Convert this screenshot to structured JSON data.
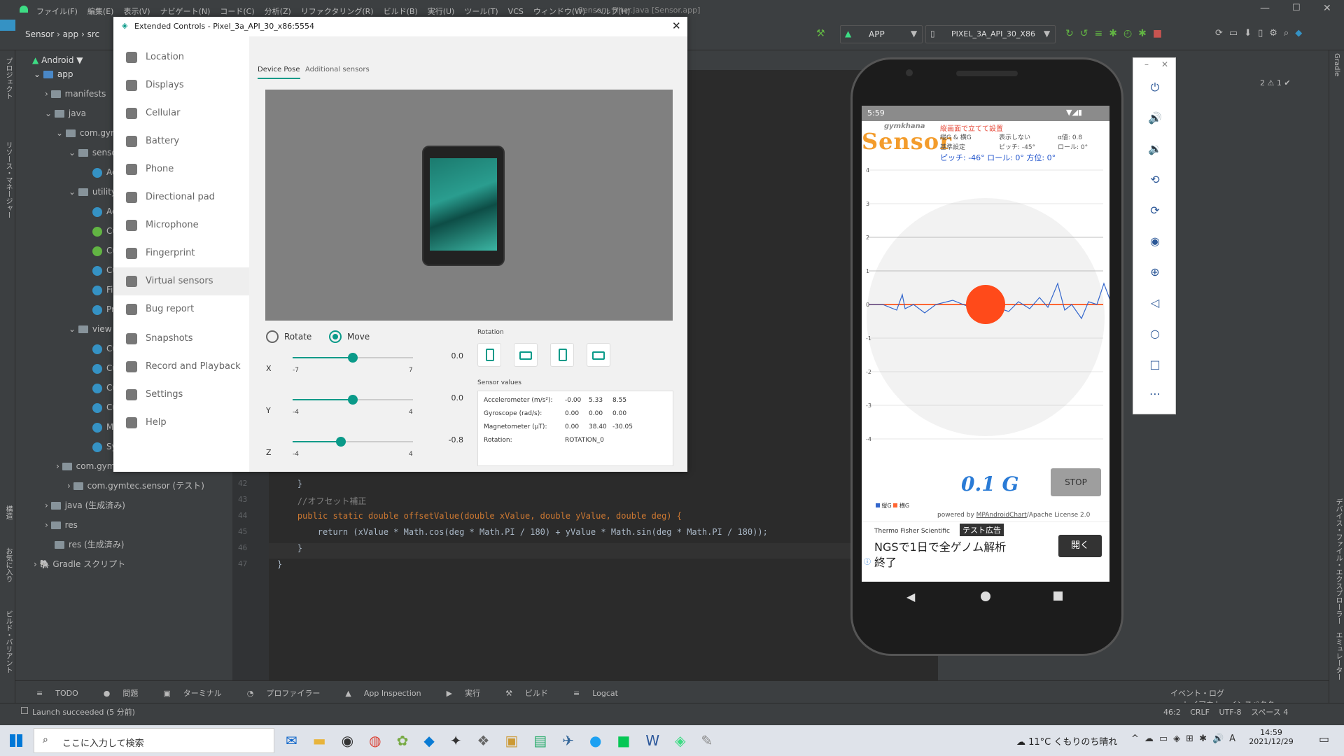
{
  "ide": {
    "menu": [
      "ファイル(F)",
      "編集(E)",
      "表示(V)",
      "ナビゲート(N)",
      "コード(C)",
      "分析(Z)",
      "リファクタリング(R)",
      "ビルド(B)",
      "実行(U)",
      "ツール(T)",
      "VCS",
      "ウィンドウ(W)",
      "ヘルプ(H)"
    ],
    "window_title": "Sensor - Filter.java [Sensor.app]",
    "breadcrumb": [
      "Sensor",
      "app",
      "src"
    ],
    "run_config": "APP",
    "device": "PIXEL_3A_API_30_X86",
    "project_view": "Android",
    "left_tool_tabs": [
      "プロジェクト",
      "リソース・マネージャー",
      "構造",
      "お気に入り",
      "ビルド・バリアント"
    ],
    "right_tool_tabs": [
      "Gradle",
      "デバイス・ファイル・エクスプローラー",
      "エミュレーター"
    ],
    "tree": {
      "app": "app",
      "manifests": "manifests",
      "java": "java",
      "pkg1": "com.gym",
      "senso": "senso",
      "utility": "utility",
      "view": "view",
      "leaf_ac": "Ac",
      "leaf_cu": "Cu",
      "leaf_fil": "Fil",
      "leaf_pr": "Pr",
      "leaf_ma": "Ma",
      "leaf_sy": "Sy",
      "pkg2": "com.gym",
      "pkg_test": "com.gymtec.sensor (テスト)",
      "java_gen": "java (生成済み)",
      "res": "res",
      "res_gen": "res (生成済み)",
      "gradle": "Gradle スクリプト"
    },
    "inspection": "2 ⚠  1 ✔",
    "code_lines": [
      {
        "n": "42",
        "t": "    }"
      },
      {
        "n": "43",
        "t": "    //オフセット補正"
      },
      {
        "n": "44",
        "t": "    public static double offsetValue(double xValue, double yValue, double deg) {"
      },
      {
        "n": "45",
        "t": "        return (xValue * Math.cos(deg * Math.PI / 180) + yValue * Math.sin(deg * Math.PI / 180));"
      },
      {
        "n": "46",
        "t": "    }"
      },
      {
        "n": "47",
        "t": "}"
      }
    ],
    "bottom_tabs": [
      "TODO",
      "問題",
      "ターミナル",
      "プロファイラー",
      "App Inspection",
      "実行",
      "ビルド",
      "Logcat"
    ],
    "bottom_right_tabs": [
      "イベント・ログ",
      "レイアウト・インスペクター"
    ],
    "status_message": "Launch succeeded (5 分前)",
    "status_right": {
      "pos": "46:2",
      "eol": "CRLF",
      "enc": "UTF-8",
      "indent": "スペース 4"
    }
  },
  "extended_controls": {
    "title": "Extended Controls - Pixel_3a_API_30_x86:5554",
    "nav": [
      "Location",
      "Displays",
      "Cellular",
      "Battery",
      "Phone",
      "Directional pad",
      "Microphone",
      "Fingerprint",
      "Virtual sensors",
      "Bug report",
      "Snapshots",
      "Record and Playback",
      "Settings",
      "Help"
    ],
    "selected_nav": "Virtual sensors",
    "tabs": [
      "Device Pose",
      "Additional sensors"
    ],
    "mode_rotate": "Rotate",
    "mode_move": "Move",
    "mode_selected": "Move",
    "sliders": [
      {
        "axis": "X",
        "min": "-7",
        "max": "7",
        "value": "0.0",
        "fraction": 0.5
      },
      {
        "axis": "Y",
        "min": "-4",
        "max": "4",
        "value": "0.0",
        "fraction": 0.5
      },
      {
        "axis": "Z",
        "min": "-4",
        "max": "4",
        "value": "-0.8",
        "fraction": 0.4
      }
    ],
    "rotation_label": "Rotation",
    "sensor_values_label": "Sensor values",
    "sensor_rows": [
      {
        "name": "Accelerometer (m/s²):",
        "v": [
          "-0.00",
          "5.33",
          "8.55"
        ]
      },
      {
        "name": "Gyroscope (rad/s):",
        "v": [
          "0.00",
          "0.00",
          "0.00"
        ]
      },
      {
        "name": "Magnetometer (μT):",
        "v": [
          "0.00",
          "38.40",
          "-30.05"
        ]
      },
      {
        "name": "Rotation:",
        "v": [
          "ROTATION_0",
          "",
          ""
        ]
      }
    ]
  },
  "phone": {
    "time": "5:59",
    "brand_small": "gymkhana",
    "brand": "Sensor",
    "notice": "縦画面で立てて設置",
    "info": [
      [
        "縦G & 横G",
        "表示しない",
        "α値: 0.8"
      ],
      [
        "基準設定",
        "ピッチ: -45°",
        "ロール: 0°"
      ]
    ],
    "readout": "ピッチ: -46° ロール: 0° 方位: 0°",
    "y_ticks": [
      "4",
      "3",
      "2",
      "1",
      "0",
      "-1",
      "-2",
      "-3",
      "-4"
    ],
    "g_value": "0.1 G",
    "stop": "STOP",
    "legend": [
      "縦G",
      "横G"
    ],
    "powered_prefix": "powered by ",
    "powered_link": "MPAndroidChart",
    "powered_suffix": "/Apache License 2.0",
    "ad_label": "テスト広告",
    "ad_company": "Thermo Fisher Scientific",
    "ad_text_1": "NGSで1日で全ゲノム解析",
    "ad_text_2": "終了",
    "ad_button": "開く",
    "colors": {
      "vertical": "#3366cc",
      "lateral": "#ff6633",
      "ball": "#ff4a1a"
    }
  },
  "taskbar": {
    "search": "ここに入力して検索",
    "weather": "11°C くもりのち晴れ",
    "time": "14:59",
    "date": "2021/12/29"
  }
}
